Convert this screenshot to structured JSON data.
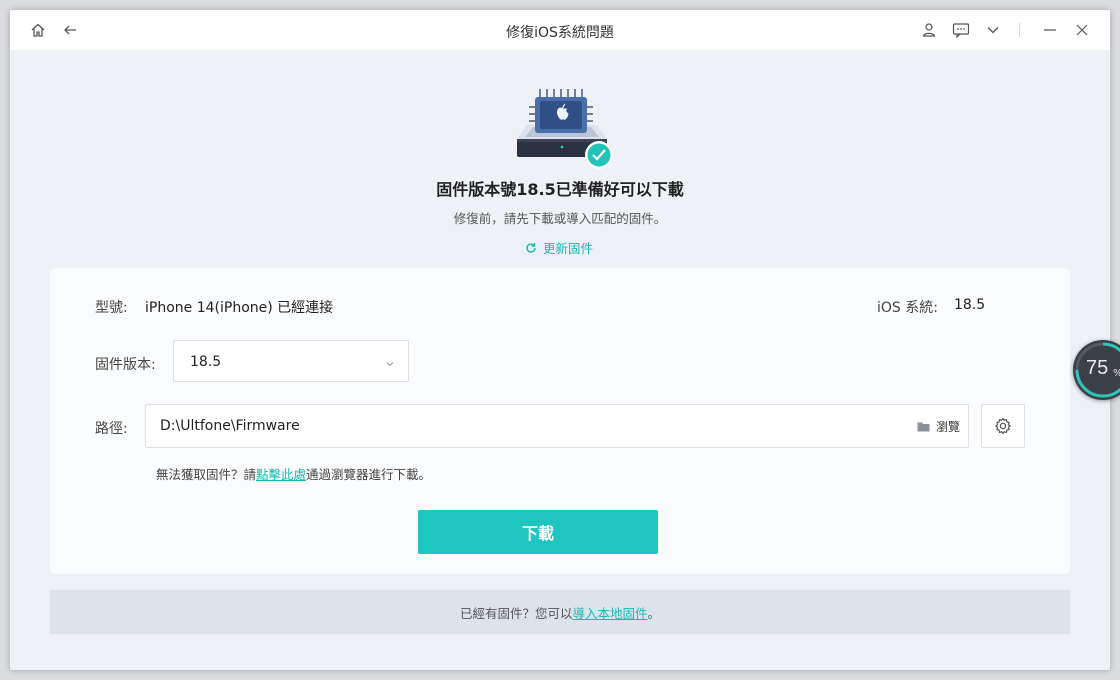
{
  "window": {
    "title": "修復iOS系統問題"
  },
  "hero": {
    "title": "固件版本號18.5已準備好可以下載",
    "subtitle": "修復前，請先下載或導入匹配的固件。",
    "update_label": "更新固件"
  },
  "device": {
    "model_label": "型號:",
    "model_value": "iPhone 14(iPhone) 已經連接",
    "ios_label": "iOS 系統:",
    "ios_value": "18.5"
  },
  "firmware": {
    "label": "固件版本:",
    "selected": "18.5"
  },
  "path": {
    "label": "路徑:",
    "value": "D:\\Ultfone\\Firmware",
    "browse_label": "瀏覽"
  },
  "hint": {
    "prefix": "無法獲取固件？請",
    "link": "點擊此處",
    "suffix": "通過瀏覽器進行下載。"
  },
  "download_button": "下載",
  "footer": {
    "prefix": "已經有固件？您可以",
    "link": "導入本地固件",
    "suffix": "。"
  },
  "gauge": {
    "value": "75",
    "unit": "%",
    "fraction": 0.75
  },
  "colors": {
    "accent": "#1ec6bf",
    "link": "#19b9b4",
    "check": "#22c3b8"
  },
  "icons": [
    "home-icon",
    "back-icon",
    "user-icon",
    "chat-icon",
    "chevron-down-icon",
    "minimize-icon",
    "close-icon",
    "refresh-icon",
    "folder-icon",
    "gear-icon",
    "check-icon",
    "chip-icon"
  ]
}
